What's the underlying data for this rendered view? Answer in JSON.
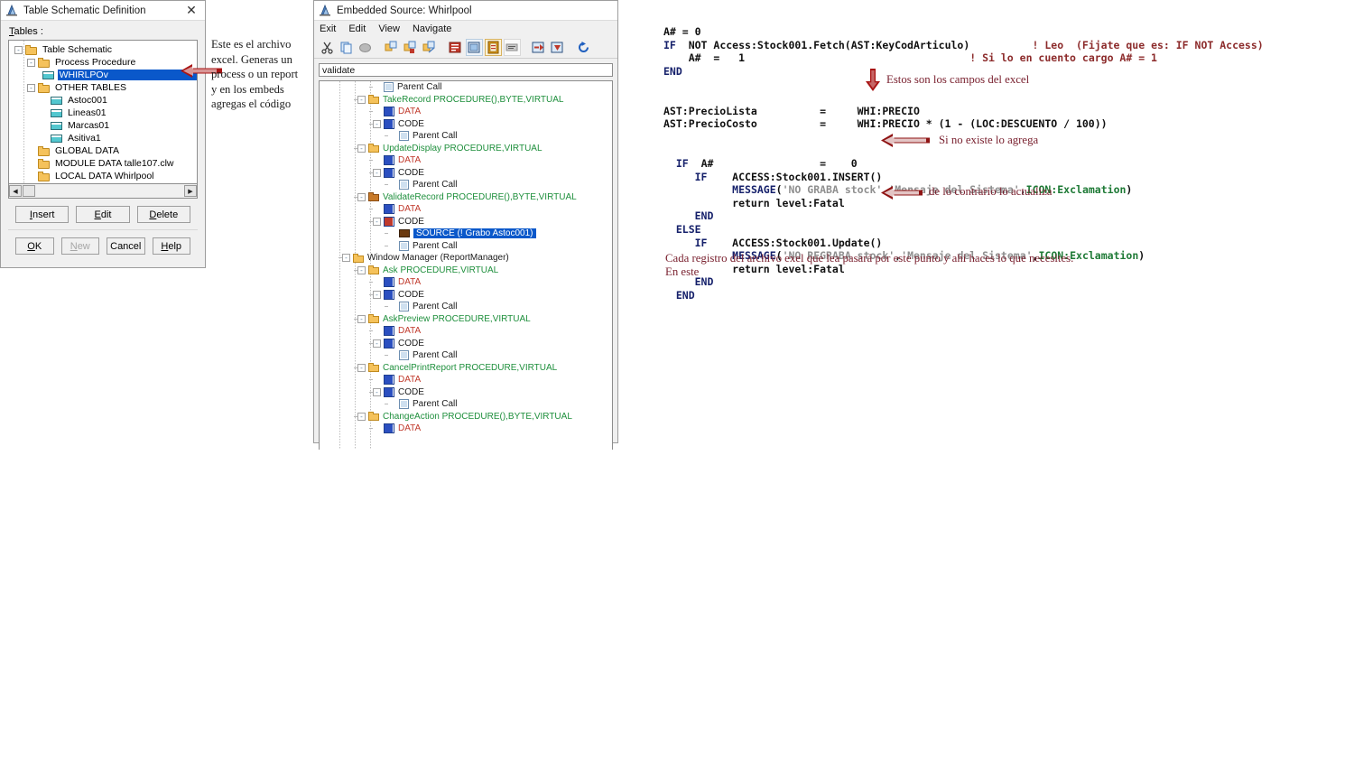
{
  "window1": {
    "title": "Table Schematic Definition",
    "close_label": "✕",
    "tables_label": "Tables :",
    "tree": [
      {
        "indent": 0,
        "expander": "-",
        "icon": "folder",
        "label": "Table Schematic",
        "selected": false
      },
      {
        "indent": 1,
        "expander": "-",
        "icon": "folder",
        "label": "Process Procedure",
        "selected": false
      },
      {
        "indent": 2,
        "expander": "",
        "icon": "table",
        "label": "WHIRLPOv",
        "selected": true
      },
      {
        "indent": 1,
        "expander": "-",
        "icon": "folder",
        "label": "OTHER TABLES",
        "selected": false
      },
      {
        "indent": 2,
        "expander": "",
        "icon": "table",
        "label": "Astoc001",
        "selected": false
      },
      {
        "indent": 2,
        "expander": "",
        "icon": "table",
        "label": "Lineas01",
        "selected": false
      },
      {
        "indent": 2,
        "expander": "",
        "icon": "table",
        "label": "Marcas01",
        "selected": false
      },
      {
        "indent": 2,
        "expander": "",
        "icon": "table",
        "label": "Asitiva1",
        "selected": false
      },
      {
        "indent": 1,
        "expander": "",
        "icon": "folder",
        "label": "GLOBAL DATA",
        "selected": false
      },
      {
        "indent": 1,
        "expander": "",
        "icon": "folder",
        "label": "MODULE DATA talle107.clw",
        "selected": false
      },
      {
        "indent": 1,
        "expander": "",
        "icon": "folder",
        "label": "LOCAL DATA Whirlpool",
        "selected": false
      }
    ],
    "scroll": {
      "left_arrow": "◀",
      "right_arrow": "▶"
    },
    "buttons_row1": [
      {
        "label": "Insert",
        "accel": "I",
        "disabled": false
      },
      {
        "label": "Edit",
        "accel": "E",
        "disabled": false
      },
      {
        "label": "Delete",
        "accel": "D",
        "disabled": false
      }
    ],
    "buttons_row2": [
      {
        "label": "OK",
        "accel": "O",
        "disabled": false
      },
      {
        "label": "New",
        "accel": "N",
        "disabled": true
      },
      {
        "label": "Cancel",
        "accel": "",
        "disabled": false
      },
      {
        "label": "Help",
        "accel": "H",
        "disabled": false
      }
    ]
  },
  "window2": {
    "title": "Embedded Source: Whirlpool",
    "menu": [
      "Exit",
      "Edit",
      "View",
      "Navigate"
    ],
    "toolbar_icons": [
      "cut-icon",
      "copy-icon",
      "paste-icon",
      "insert-embed-icon",
      "delete-embed-icon",
      "edit-embed-icon",
      "source-icon",
      "properties-icon",
      "highlighted-embed-icon",
      "comment-icon",
      "move-up-icon",
      "move-down-icon",
      "refresh-icon"
    ],
    "path_value": "validate",
    "tree": [
      {
        "indent": 3,
        "expander": "",
        "icon": "parent-call",
        "label": "Parent Call",
        "color": "dark"
      },
      {
        "indent": 2,
        "expander": "-",
        "icon": "folder",
        "label": "TakeRecord PROCEDURE(),BYTE,VIRTUAL",
        "color": "green"
      },
      {
        "indent": 3,
        "expander": "",
        "icon": "embed",
        "label": "DATA",
        "color": "red"
      },
      {
        "indent": 3,
        "expander": "-",
        "icon": "embed",
        "label": "CODE",
        "color": "dark"
      },
      {
        "indent": 4,
        "expander": "",
        "icon": "parent-call",
        "label": "Parent Call",
        "color": "dark"
      },
      {
        "indent": 2,
        "expander": "-",
        "icon": "folder",
        "label": "UpdateDisplay PROCEDURE,VIRTUAL",
        "color": "green"
      },
      {
        "indent": 3,
        "expander": "",
        "icon": "embed",
        "label": "DATA",
        "color": "red"
      },
      {
        "indent": 3,
        "expander": "-",
        "icon": "embed",
        "label": "CODE",
        "color": "dark"
      },
      {
        "indent": 4,
        "expander": "",
        "icon": "parent-call",
        "label": "Parent Call",
        "color": "dark"
      },
      {
        "indent": 2,
        "expander": "-",
        "icon": "folder-brown",
        "label": "ValidateRecord PROCEDURE(),BYTE,VIRTUAL",
        "color": "green"
      },
      {
        "indent": 3,
        "expander": "",
        "icon": "embed",
        "label": "DATA",
        "color": "red"
      },
      {
        "indent": 3,
        "expander": "-",
        "icon": "embed-red",
        "label": "CODE",
        "color": "dark"
      },
      {
        "indent": 4,
        "expander": "",
        "icon": "source",
        "label": "SOURCE (!  Grabo  Astoc001)",
        "color": "selected"
      },
      {
        "indent": 4,
        "expander": "",
        "icon": "parent-call",
        "label": "Parent Call",
        "color": "dark"
      },
      {
        "indent": 1,
        "expander": "-",
        "icon": "folder",
        "label": "Window Manager (ReportManager)",
        "color": "dark"
      },
      {
        "indent": 2,
        "expander": "-",
        "icon": "folder",
        "label": "Ask PROCEDURE,VIRTUAL",
        "color": "green"
      },
      {
        "indent": 3,
        "expander": "",
        "icon": "embed",
        "label": "DATA",
        "color": "red"
      },
      {
        "indent": 3,
        "expander": "-",
        "icon": "embed",
        "label": "CODE",
        "color": "dark"
      },
      {
        "indent": 4,
        "expander": "",
        "icon": "parent-call",
        "label": "Parent Call",
        "color": "dark"
      },
      {
        "indent": 2,
        "expander": "-",
        "icon": "folder",
        "label": "AskPreview PROCEDURE,VIRTUAL",
        "color": "green"
      },
      {
        "indent": 3,
        "expander": "",
        "icon": "embed",
        "label": "DATA",
        "color": "red"
      },
      {
        "indent": 3,
        "expander": "-",
        "icon": "embed",
        "label": "CODE",
        "color": "dark"
      },
      {
        "indent": 4,
        "expander": "",
        "icon": "parent-call",
        "label": "Parent Call",
        "color": "dark"
      },
      {
        "indent": 2,
        "expander": "-",
        "icon": "folder",
        "label": "CancelPrintReport PROCEDURE,VIRTUAL",
        "color": "green"
      },
      {
        "indent": 3,
        "expander": "",
        "icon": "embed",
        "label": "DATA",
        "color": "red"
      },
      {
        "indent": 3,
        "expander": "-",
        "icon": "embed",
        "label": "CODE",
        "color": "dark"
      },
      {
        "indent": 4,
        "expander": "",
        "icon": "parent-call",
        "label": "Parent Call",
        "color": "dark"
      },
      {
        "indent": 2,
        "expander": "-",
        "icon": "folder",
        "label": "ChangeAction PROCEDURE(),BYTE,VIRTUAL",
        "color": "green"
      },
      {
        "indent": 3,
        "expander": "",
        "icon": "embed",
        "label": "DATA",
        "color": "red"
      }
    ]
  },
  "code": {
    "lines": [
      [
        {
          "t": "A# = 0",
          "c": "nm"
        }
      ],
      [
        {
          "t": "IF  ",
          "c": "kw"
        },
        {
          "t": "NOT Access:Stock001.Fetch(AST:KeyCodArticulo)",
          "c": "nm"
        },
        {
          "t": "          ",
          "c": "nm"
        },
        {
          "t": "! Leo  (Fijate que es: IF NOT Access)",
          "c": "cm"
        }
      ],
      [
        {
          "t": "    A#  =   1",
          "c": "nm"
        },
        {
          "t": "                                    ",
          "c": "nm"
        },
        {
          "t": "! Si lo en cuento cargo A# = 1",
          "c": "cm"
        }
      ],
      [
        {
          "t": "END",
          "c": "kw"
        }
      ],
      [
        {
          "t": "",
          "c": "nm"
        }
      ],
      [
        {
          "t": "",
          "c": "nm"
        }
      ],
      [
        {
          "t": "AST:PrecioLista          =     WHI:PRECIO",
          "c": "nm"
        }
      ],
      [
        {
          "t": "AST:PrecioCosto          =     WHI:PRECIO * (1 - (LOC:DESCUENTO / 100))",
          "c": "nm"
        }
      ],
      [
        {
          "t": "",
          "c": "nm"
        }
      ],
      [
        {
          "t": "",
          "c": "nm"
        }
      ],
      [
        {
          "t": "  ",
          "c": "nm"
        },
        {
          "t": "IF",
          "c": "kw"
        },
        {
          "t": "  A#                 =    0",
          "c": "nm"
        }
      ],
      [
        {
          "t": "     ",
          "c": "nm"
        },
        {
          "t": "IF",
          "c": "kw"
        },
        {
          "t": "    ACCESS:Stock001.INSERT()",
          "c": "nm"
        }
      ],
      [
        {
          "t": "           ",
          "c": "nm"
        },
        {
          "t": "MESSAGE",
          "c": "kw"
        },
        {
          "t": "(",
          "c": "nm"
        },
        {
          "t": "'NO GRABA stock'",
          "c": "str"
        },
        {
          "t": ",",
          "c": "nm"
        },
        {
          "t": "'Mensaje del Sistema'",
          "c": "str"
        },
        {
          "t": ",",
          "c": "nm"
        },
        {
          "t": "ICON:Exclamation",
          "c": "grn"
        },
        {
          "t": ")",
          "c": "nm"
        }
      ],
      [
        {
          "t": "           return level:Fatal",
          "c": "nm"
        }
      ],
      [
        {
          "t": "     ",
          "c": "nm"
        },
        {
          "t": "END",
          "c": "kw"
        }
      ],
      [
        {
          "t": "  ",
          "c": "nm"
        },
        {
          "t": "ELSE",
          "c": "kw"
        }
      ],
      [
        {
          "t": "     ",
          "c": "nm"
        },
        {
          "t": "IF",
          "c": "kw"
        },
        {
          "t": "    ACCESS:Stock001.Update()",
          "c": "nm"
        }
      ],
      [
        {
          "t": "           ",
          "c": "nm"
        },
        {
          "t": "MESSAGE",
          "c": "kw"
        },
        {
          "t": "(",
          "c": "nm"
        },
        {
          "t": "'NO REGRABA stock'",
          "c": "str"
        },
        {
          "t": ",",
          "c": "nm"
        },
        {
          "t": "'Mensaje del Sistema'",
          "c": "str"
        },
        {
          "t": ",",
          "c": "nm"
        },
        {
          "t": "ICON:Exclamation",
          "c": "grn"
        },
        {
          "t": ")",
          "c": "nm"
        }
      ],
      [
        {
          "t": "           return level:Fatal",
          "c": "nm"
        }
      ],
      [
        {
          "t": "     ",
          "c": "nm"
        },
        {
          "t": "END",
          "c": "kw"
        }
      ],
      [
        {
          "t": "  ",
          "c": "nm"
        },
        {
          "t": "END",
          "c": "kw"
        }
      ]
    ]
  },
  "annotations": {
    "left_note": "Este es el archivo\nexcel. Generas un\nprocess o un report\ny en los embeds\nagregas el código",
    "fields_note": "Estos son los campos del excel",
    "insert_note": "Si no existe lo agrega",
    "update_note": "de lo contrario lo actualiza",
    "bottom_note": "Cada registro del archivo exel que lea pasará por este punto y ahi haces lo que necesites.",
    "bottom_note2": "En este"
  },
  "colors": {
    "selection_blue": "#0a58ca",
    "annotation_red": "#7a2230",
    "arrow_red": "#8f1b1b",
    "comment_red": "#8c2b2b",
    "keyword_blue": "#16216b",
    "green_label": "#1e8f3c",
    "data_red": "#c0392b"
  }
}
